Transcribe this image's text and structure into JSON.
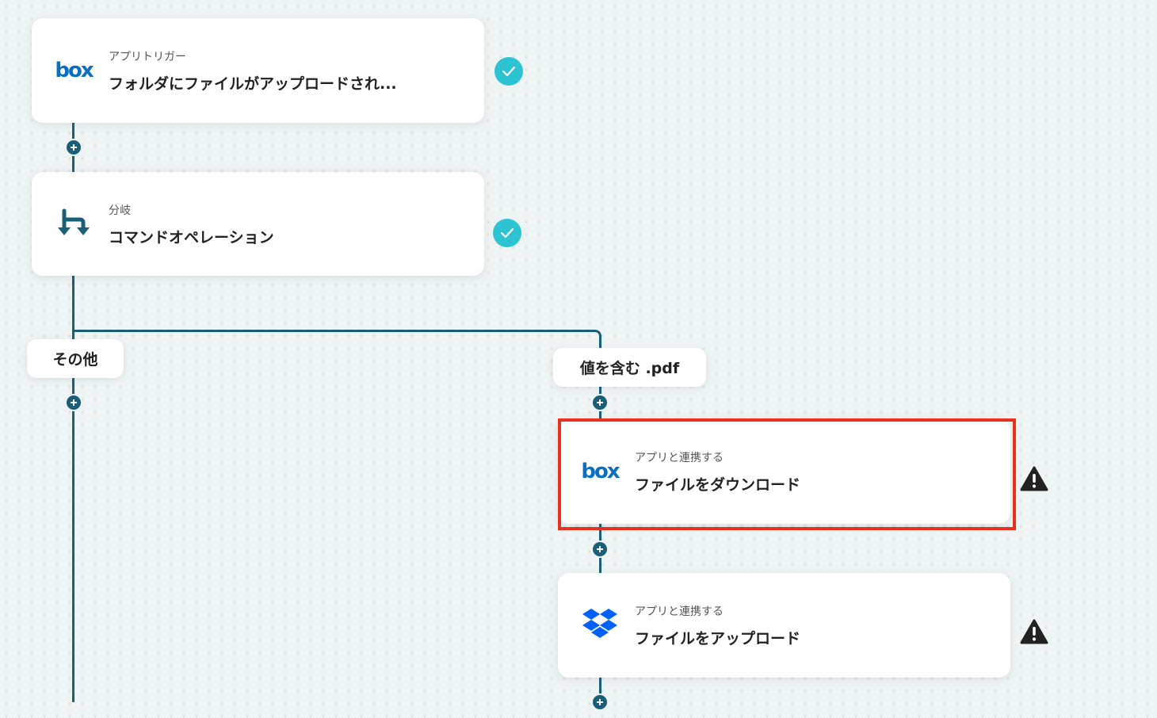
{
  "nodes": {
    "trigger": {
      "subtitle": "アプリトリガー",
      "title": "フォルダにファイルがアップロードされ...",
      "icon": "box-logo-icon",
      "logo_text": "box",
      "status": "complete"
    },
    "branch": {
      "subtitle": "分岐",
      "title": "コマンドオペレーション",
      "icon": "branch-icon",
      "status": "complete"
    },
    "box_download": {
      "subtitle": "アプリと連携する",
      "title": "ファイルをダウンロード",
      "icon": "box-logo-icon",
      "logo_text": "box",
      "status": "warning",
      "selected": true
    },
    "dropbox_upload": {
      "subtitle": "アプリと連携する",
      "title": "ファイルをアップロード",
      "icon": "dropbox-icon",
      "status": "warning"
    }
  },
  "branch_labels": {
    "other": "その他",
    "condition": "値を含む .pdf"
  },
  "colors": {
    "connector": "#1a5f78",
    "check": "#2cc3d3",
    "highlight": "#e8321f",
    "box_brand": "#0a6fc2",
    "dropbox_brand": "#0061fe",
    "background": "#eef3f3"
  }
}
